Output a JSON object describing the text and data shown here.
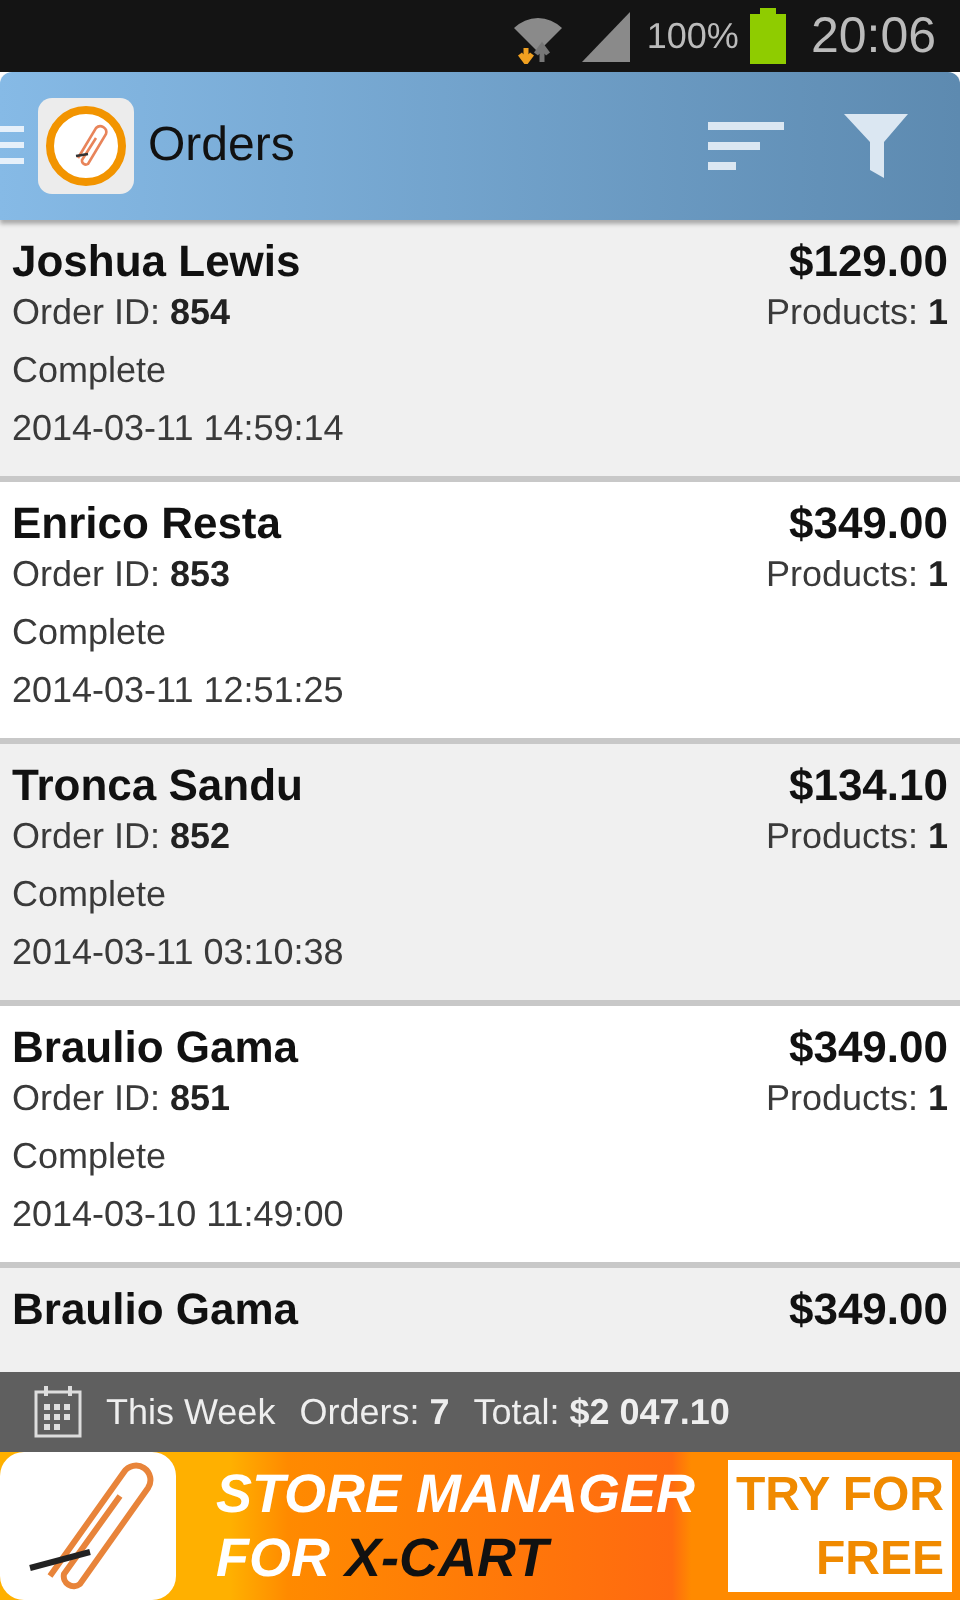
{
  "status_bar": {
    "battery": "100%",
    "time": "20:06"
  },
  "app_bar": {
    "title": "Orders"
  },
  "orders": [
    {
      "customer": "Joshua Lewis",
      "total": "$129.00",
      "order_id_label": "Order ID:",
      "order_id": "854",
      "products_label": "Products:",
      "products": "1",
      "status": "Complete",
      "date": "2014-03-11 14:59:14"
    },
    {
      "customer": "Enrico Resta",
      "total": "$349.00",
      "order_id_label": "Order ID:",
      "order_id": "853",
      "products_label": "Products:",
      "products": "1",
      "status": "Complete",
      "date": "2014-03-11 12:51:25"
    },
    {
      "customer": "Tronca Sandu",
      "total": "$134.10",
      "order_id_label": "Order ID:",
      "order_id": "852",
      "products_label": "Products:",
      "products": "1",
      "status": "Complete",
      "date": "2014-03-11 03:10:38"
    },
    {
      "customer": "Braulio Gama",
      "total": "$349.00",
      "order_id_label": "Order ID:",
      "order_id": "851",
      "products_label": "Products:",
      "products": "1",
      "status": "Complete",
      "date": "2014-03-10 11:49:00"
    },
    {
      "customer": "Braulio Gama",
      "total": "$349.00"
    }
  ],
  "summary": {
    "period": "This Week",
    "orders_label": "Orders:",
    "orders": "7",
    "total_label": "Total:",
    "total": "$2 047.10"
  },
  "banner": {
    "headline": "STORE MANAGER",
    "subline_prefix": "FOR",
    "subline_product": "X-CART",
    "cta_line1": "TRY FOR",
    "cta_line2": "FREE"
  }
}
